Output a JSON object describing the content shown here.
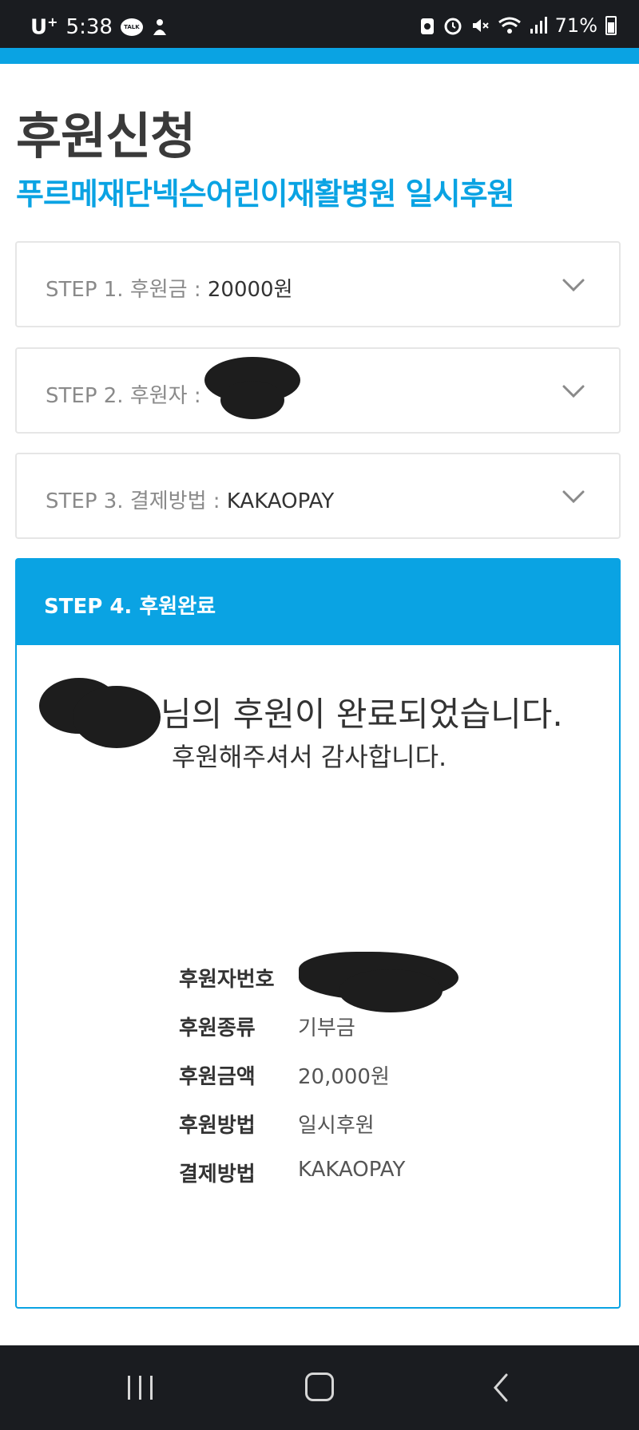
{
  "status_bar": {
    "carrier": "U",
    "carrier_suffix": "+",
    "time": "5:38",
    "talk_icon_label": "TALK",
    "battery": "71%",
    "icons": [
      "talk-icon",
      "person-icon",
      "recycle-icon",
      "alarm-icon",
      "mute-icon",
      "wifi-icon",
      "signal-icon",
      "battery-icon"
    ]
  },
  "header": {
    "title": "후원신청",
    "subtitle": "푸르메재단넥슨어린이재활병원 일시후원"
  },
  "steps": [
    {
      "label": "STEP 1. 후원금 : ",
      "value": "20000원"
    },
    {
      "label": "STEP 2. 후원자 : ",
      "value": ""
    },
    {
      "label": "STEP 3. 결제방법 : ",
      "value": "KAKAOPAY"
    }
  ],
  "step4": {
    "title": "STEP 4. 후원완료",
    "complete_message": "님의 후원이 완료되었습니다.",
    "thanks_message": "후원해주셔서 감사합니다.",
    "info": [
      {
        "key": "후원자번호",
        "value": ""
      },
      {
        "key": "후원종류",
        "value": "기부금"
      },
      {
        "key": "후원금액",
        "value": "20,000원"
      },
      {
        "key": "후원방법",
        "value": "일시후원"
      },
      {
        "key": "결제방법",
        "value": "KAKAOPAY"
      }
    ]
  },
  "colors": {
    "accent": "#0aa3e3",
    "status_bar": "#1a1c20",
    "title_text": "#3a3a3a"
  }
}
